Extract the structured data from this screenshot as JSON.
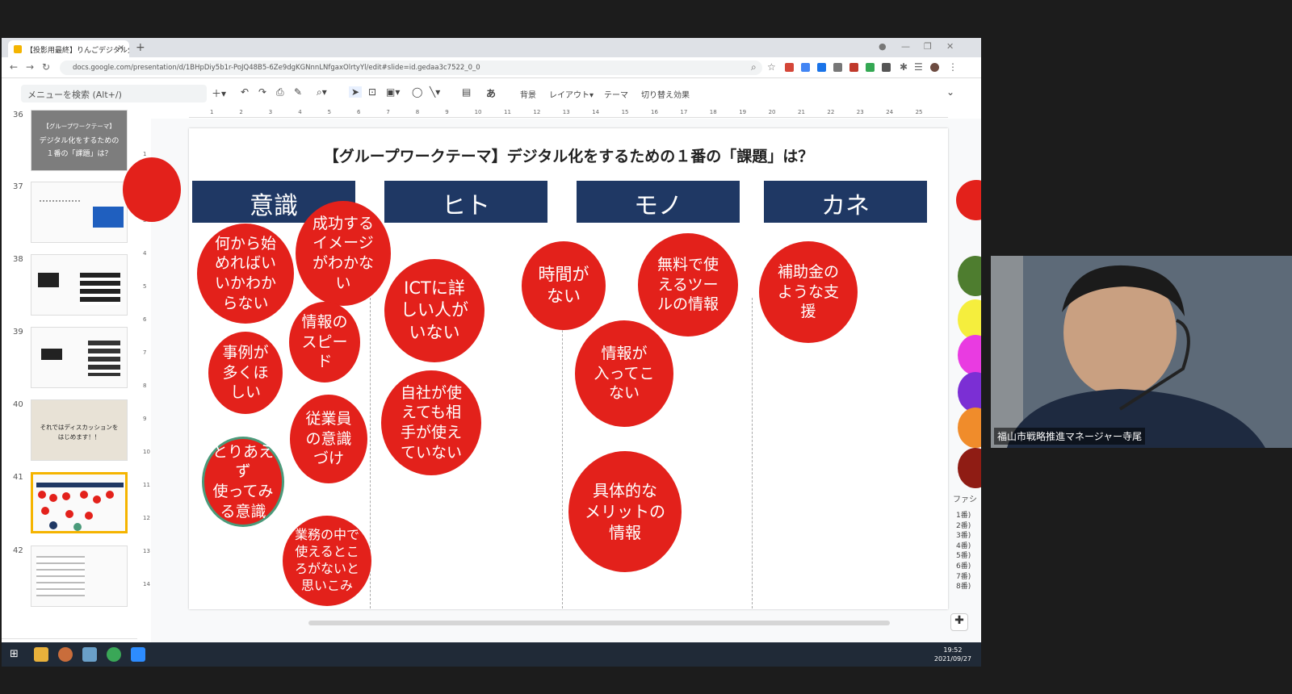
{
  "browser": {
    "tab_title": "【投影用最終】りんごデジタル分析 手",
    "tab_close": "×",
    "new_tab": "+",
    "url": "docs.google.com/presentation/d/1BHpDiy5b1r-PoJQ48B5-6Ze9dgKGNnnLNfgaxOlrtyYl/edit#slide=id.gedaa3c7522_0_0"
  },
  "toolbar": {
    "menu_search_placeholder": "メニューを検索 (Alt+/)",
    "background_label": "背景",
    "layout_label": "レイアウト▾",
    "theme_label": "テーマ",
    "transition_label": "切り替え効果",
    "text_a_label": "あ"
  },
  "filmstrip": {
    "slides": [
      {
        "num": "36",
        "text1": "【グループワークテーマ】",
        "text2": "デジタル化をするための",
        "text3": "１番の「課題」は？"
      },
      {
        "num": "37"
      },
      {
        "num": "38"
      },
      {
        "num": "39"
      },
      {
        "num": "40",
        "text1": "それではディスカッションを",
        "text2": "はじめます！！"
      },
      {
        "num": "41"
      },
      {
        "num": "42"
      }
    ]
  },
  "ruler": [
    "1",
    "2",
    "3",
    "4",
    "5",
    "6",
    "7",
    "8",
    "9",
    "10",
    "11",
    "12",
    "13",
    "14",
    "15",
    "16",
    "17",
    "18",
    "19",
    "20",
    "21",
    "22",
    "23",
    "24",
    "25"
  ],
  "vruler": [
    "1",
    "2",
    "3",
    "4",
    "5",
    "6",
    "7",
    "8",
    "9",
    "10",
    "11",
    "12",
    "13",
    "14"
  ],
  "slide": {
    "title": "【グループワークテーマ】デジタル化をするための１番の「課題」は？",
    "columns": [
      "意識",
      "ヒト",
      "モノ",
      "カネ"
    ],
    "bubbles": [
      "何から始\nめればい\nいかわか\nらない",
      "成功する\nイメージ\nがわかな\nい",
      "情報の\nスピー\nド",
      "事例が\n多くほ\nしい",
      "従業員\nの意識\nづけ",
      "とりあえ\nず\n使ってみ\nる意識",
      "業務の中で\n使えるとこ\nろがないと\n思いこみ",
      "ICTに詳\nしい人が\nいない",
      "自社が使\nえても相\n手が使え\nていない",
      "時間が\nない",
      "無料で使\nえるツー\nルの情報",
      "情報が\n入ってこ\nない",
      "具体的な\nメリットの\n情報",
      "補助金の\nような支\n援"
    ]
  },
  "video": {
    "participant_name": "福山市戦略推進マネージャー寺尾"
  },
  "side_panel": {
    "label": "ファシ",
    "items": [
      "1番)",
      "2番)",
      "3番)",
      "4番)",
      "5番)",
      "6番)",
      "7番)",
      "8番)"
    ]
  },
  "taskbar": {
    "time": "19:52",
    "date": "2021/09/27"
  },
  "colors": {
    "header_navy": "#1f3864",
    "bubble_red": "#e3211b",
    "ring_green": "#4a9a7a",
    "selected_thumb": "#f5b400"
  }
}
